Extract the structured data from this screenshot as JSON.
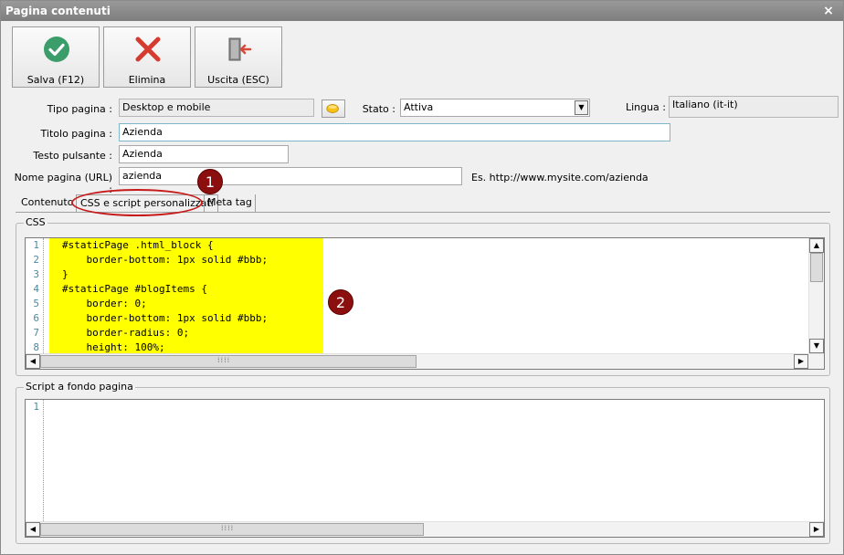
{
  "window": {
    "title": "Pagina contenuti",
    "close_glyph": "×"
  },
  "toolbar": {
    "save_label": "Salva (F12)",
    "delete_label": "Elimina",
    "exit_label": "Uscita (ESC)",
    "save_icon": "checkmark-circle-icon",
    "delete_icon": "red-x-icon",
    "exit_icon": "door-exit-icon"
  },
  "form": {
    "tipo_label": "Tipo pagina :",
    "tipo_value": "Desktop e mobile",
    "stato_label": "Stato :",
    "stato_value": "Attiva",
    "lingua_label": "Lingua :",
    "lingua_value": "Italiano (it-it)",
    "titolo_label": "Titolo pagina :",
    "titolo_value": "Azienda",
    "testo_label": "Testo pulsante :",
    "testo_value": "Azienda",
    "nome_label": "Nome pagina (URL) :",
    "nome_value": "azienda",
    "url_example": "Es. http://www.mysite.com/azienda"
  },
  "tabs": [
    {
      "label": "Contenuto",
      "active": false
    },
    {
      "label": "CSS e script personalizzati",
      "active": true
    },
    {
      "label": "Meta tag",
      "active": false
    }
  ],
  "annotations": {
    "badge1": "1",
    "badge2": "2",
    "accent": "#8b0f0f",
    "ellipse_color": "#c61a1a"
  },
  "css_editor": {
    "title": "CSS",
    "line_numbers": [
      "1",
      "2",
      "3",
      "4",
      "5",
      "6",
      "7",
      "8"
    ],
    "lines": [
      "#staticPage .html_block {",
      "    border-bottom: 1px solid #bbb;",
      "}",
      "#staticPage #blogItems {",
      "    border: 0;",
      "    border-bottom: 1px solid #bbb;",
      "    border-radius: 0;",
      "    height: 100%;"
    ],
    "highlight_color": "#ffff00"
  },
  "script_editor": {
    "title": "Script a fondo pagina",
    "line_numbers": [
      "1"
    ]
  }
}
